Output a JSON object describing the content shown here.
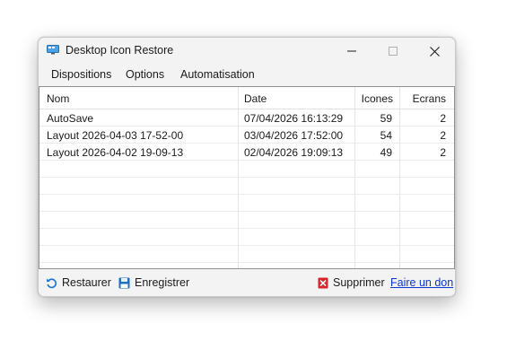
{
  "window": {
    "title": "Desktop Icon Restore"
  },
  "menu": [
    "Dispositions",
    "Options",
    "Automatisation"
  ],
  "table": {
    "columns": [
      "Nom",
      "Date",
      "Icones",
      "Ecrans"
    ],
    "rows": [
      [
        "AutoSave",
        "07/04/2026 16:13:29",
        "59",
        "2"
      ],
      [
        "Layout 2026-04-03 17-52-00",
        "03/04/2026 17:52:00",
        "54",
        "2"
      ],
      [
        "Layout 2026-04-02 19-09-13",
        "02/04/2026 19:09:13",
        "49",
        "2"
      ]
    ]
  },
  "toolbar": {
    "restore_label": "Restaurer",
    "save_label": "Enregistrer",
    "delete_label": "Supprimer",
    "donate_link": "Faire un don"
  },
  "colors": {
    "link": "#0b36d6",
    "delete_icon": "#d9262c",
    "restore_icon": "#1976d2",
    "save_icon": "#1e6fc8"
  }
}
